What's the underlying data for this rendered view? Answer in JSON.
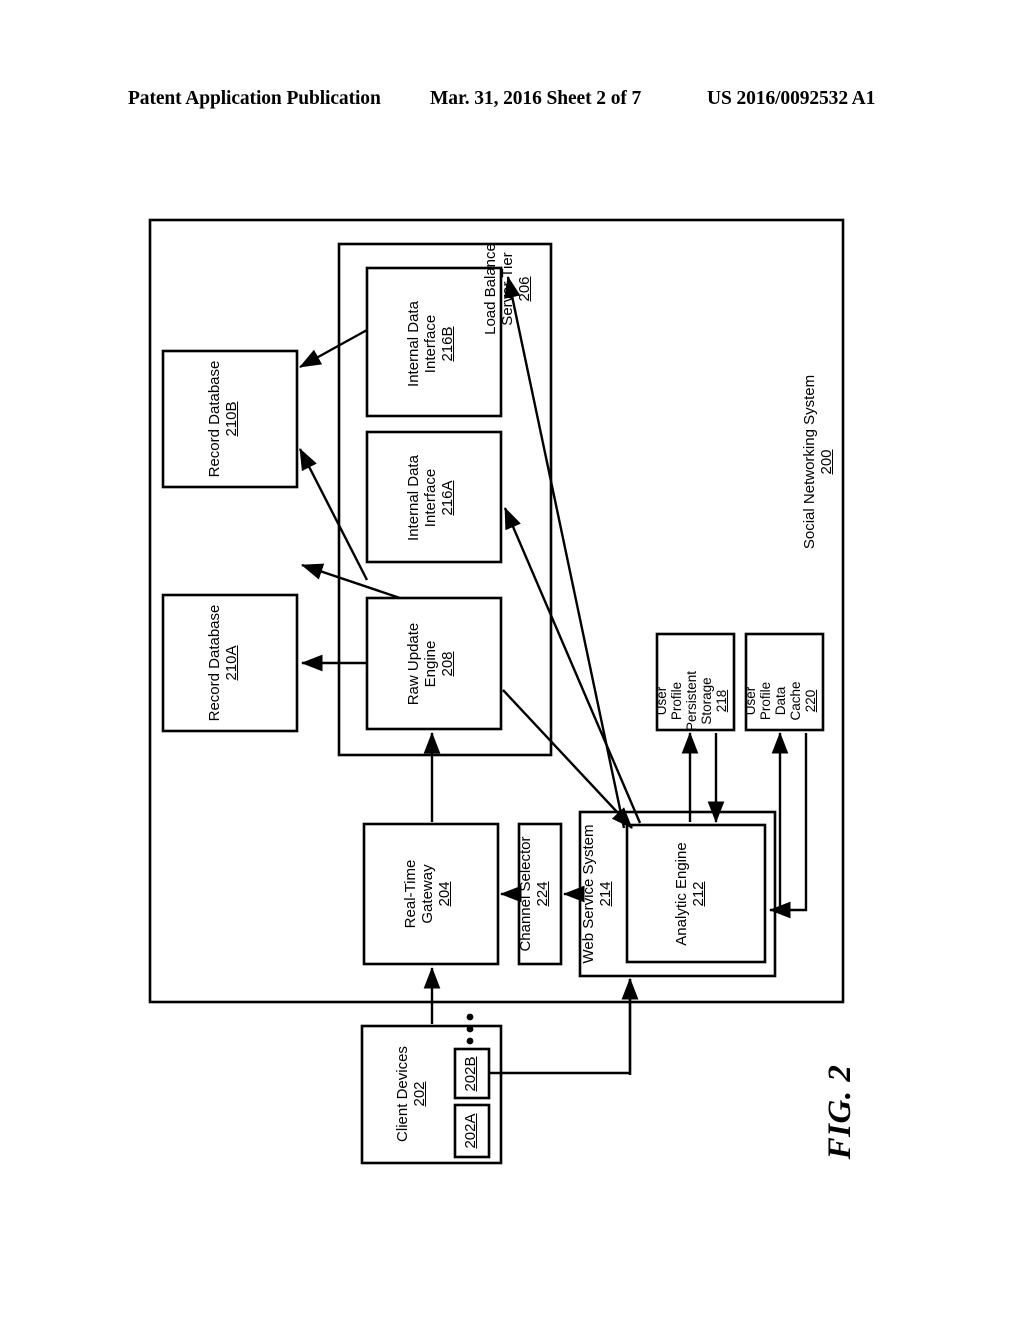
{
  "header": {
    "left": "Patent Application Publication",
    "middle": "Mar. 31, 2016  Sheet 2 of 7",
    "right": "US 2016/0092532 A1"
  },
  "figure": {
    "caption": "FIG. 2"
  },
  "diagram": {
    "outer_container": {
      "title": "Social Networking System",
      "number": "200"
    },
    "load_balance_container": {
      "title_line1": "Load Balance",
      "title_line2": "Server Tier",
      "number": "206"
    },
    "web_service_container": {
      "title_line1": "Web Service System",
      "number": "214"
    },
    "blocks": [
      {
        "id": "record-database-210b",
        "lines": [
          "Record Database"
        ],
        "number": "210B"
      },
      {
        "id": "record-database-210a",
        "lines": [
          "Record Database"
        ],
        "number": "210A"
      },
      {
        "id": "internal-data-interface-216b",
        "lines": [
          "Internal Data",
          "Interface"
        ],
        "number": "216B"
      },
      {
        "id": "internal-data-interface-216a",
        "lines": [
          "Internal Data",
          "Interface"
        ],
        "number": "216A"
      },
      {
        "id": "raw-update-engine-208",
        "lines": [
          "Raw Update",
          "Engine"
        ],
        "number": "208"
      },
      {
        "id": "user-profile-persistent-storage-218",
        "lines": [
          "User",
          "Profile",
          "Persistent",
          "Storage"
        ],
        "number": "218"
      },
      {
        "id": "user-profile-data-cache-220",
        "lines": [
          "User",
          "Profile",
          "Data",
          "Cache"
        ],
        "number": "220"
      },
      {
        "id": "real-time-gateway-204",
        "lines": [
          "Real-Time",
          "Gateway"
        ],
        "number": "204"
      },
      {
        "id": "channel-selector-224",
        "lines": [
          "Channel Selector"
        ],
        "number": "224"
      },
      {
        "id": "analytic-engine-212",
        "lines": [
          "Analytic Engine"
        ],
        "number": "212"
      },
      {
        "id": "client-devices-202",
        "lines": [
          "Client Devices"
        ],
        "number": "202"
      },
      {
        "id": "client-device-202b",
        "lines": [],
        "number": "202B"
      },
      {
        "id": "client-device-202a",
        "lines": [],
        "number": "202A"
      }
    ],
    "labels": {
      "record_database_210b_l1": "Record Database",
      "record_database_210b_num": "210B",
      "record_database_210a_l1": "Record Database",
      "record_database_210a_num": "210A",
      "idi_216b_l1": "Internal Data",
      "idi_216b_l2": "Interface",
      "idi_216b_num": "216B",
      "idi_216a_l1": "Internal Data",
      "idi_216a_l2": "Interface",
      "idi_216a_num": "216A",
      "rue_l1": "Raw Update",
      "rue_l2": "Engine",
      "rue_num": "208",
      "upps_l1": "User",
      "upps_l2": "Profile",
      "upps_l3": "Persistent",
      "upps_l4": "Storage",
      "upps_num": "218",
      "updc_l1": "User",
      "updc_l2": "Profile",
      "updc_l3": "Data",
      "updc_l4": "Cache",
      "updc_num": "220",
      "rtg_l1": "Real-Time",
      "rtg_l2": "Gateway",
      "rtg_num": "204",
      "cs_l1": "Channel Selector",
      "cs_num": "224",
      "wss_l1": "Web Service System",
      "wss_num": "214",
      "ae_l1": "Analytic Engine",
      "ae_num": "212",
      "cd_l1": "Client Devices",
      "cd_num": "202",
      "cd_202b": "202B",
      "cd_202a": "202A",
      "lbst_l1": "Load Balance",
      "lbst_l2": "Server Tier",
      "lbst_num": "206",
      "sns_l1": "Social Networking System",
      "sns_num": "200"
    }
  }
}
